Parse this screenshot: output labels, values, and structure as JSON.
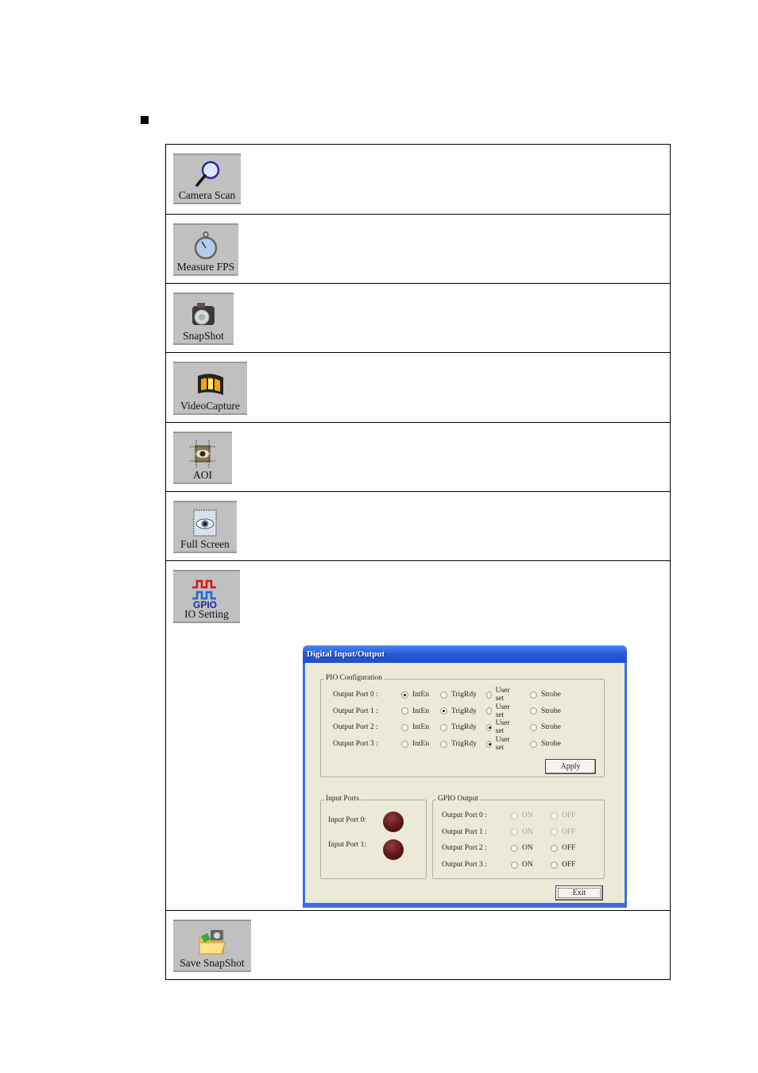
{
  "toolbar_buttons": [
    {
      "label": "Camera Scan",
      "icon": "magnifier-icon"
    },
    {
      "label": "Measure FPS",
      "icon": "stopwatch-icon"
    },
    {
      "label": "SnapShot",
      "icon": "camera-icon"
    },
    {
      "label": "VideoCapture",
      "icon": "film-strip-icon"
    },
    {
      "label": "AOI",
      "icon": "eye-selection-icon"
    },
    {
      "label": "Full Screen",
      "icon": "eye-fullscreen-icon"
    },
    {
      "label": "IO Setting",
      "icon": "gpio-icon",
      "icon_text": "GPIO"
    },
    {
      "label": "Save SnapShot",
      "icon": "folder-camera-icon"
    }
  ],
  "dialog": {
    "title": "Digital Input/Output",
    "pio": {
      "legend": "PIO Configuration",
      "options": [
        "IntEn",
        "TrigRdy",
        "User set",
        "Strobe"
      ],
      "ports": [
        {
          "label": "Output Port 0 :",
          "selected": 0
        },
        {
          "label": "Output Port 1 :",
          "selected": 1
        },
        {
          "label": "Output Port 2 :",
          "selected": 2
        },
        {
          "label": "Output Port 3 :",
          "selected": 2
        }
      ],
      "apply_label": "Apply"
    },
    "inputs": {
      "legend": "Input Ports",
      "ports": [
        {
          "label": "Input Port 0:",
          "state": "off"
        },
        {
          "label": "Input Port 1:",
          "state": "off"
        }
      ]
    },
    "gpio_output": {
      "legend": "GPIO Output",
      "on_label": "ON",
      "off_label": "OFF",
      "ports": [
        {
          "label": "Output Port 0 :",
          "enabled": false
        },
        {
          "label": "Output Port 1 :",
          "enabled": false
        },
        {
          "label": "Output Port 2 :",
          "enabled": true
        },
        {
          "label": "Output Port 3 :",
          "enabled": true
        }
      ]
    },
    "exit_label": "Exit"
  }
}
